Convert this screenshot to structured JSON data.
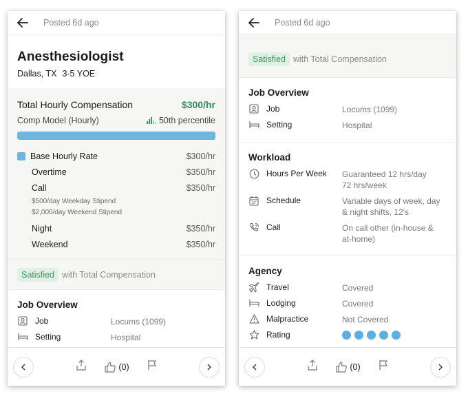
{
  "left": {
    "header": {
      "posted": "Posted 6d ago"
    },
    "job": {
      "title": "Anesthesiologist",
      "location": "Dallas, TX",
      "experience": "3-5 YOE"
    },
    "comp": {
      "label": "Total Hourly Compensation",
      "value": "$300/hr",
      "model": "Comp Model (Hourly)",
      "percentile": "50th percentile",
      "bar_fill_fraction": 1.0,
      "base": {
        "label": "Base Hourly Rate",
        "value": "$300/hr"
      },
      "overtime": {
        "label": "Overtime",
        "value": "$350/hr"
      },
      "call": {
        "label": "Call",
        "value": "$350/hr"
      },
      "stipend_weekday": "$500/day Weekday Stipend",
      "stipend_weekend": "$2,000/day Weekend Stipend",
      "night": {
        "label": "Night",
        "value": "$350/hr"
      },
      "weekend": {
        "label": "Weekend",
        "value": "$350/hr"
      }
    },
    "satisfaction": {
      "badge": "Satisfied",
      "text": "with Total Compensation"
    },
    "overview": {
      "title": "Job Overview",
      "job": {
        "label": "Job",
        "value": "Locums (1099)"
      },
      "setting": {
        "label": "Setting",
        "value": "Hospital"
      }
    },
    "footer": {
      "likes": "(0)"
    }
  },
  "right": {
    "header": {
      "posted": "Posted 6d ago"
    },
    "satisfaction": {
      "badge": "Satisfied",
      "text": "with Total Compensation"
    },
    "overview": {
      "title": "Job Overview",
      "job": {
        "label": "Job",
        "value": "Locums (1099)"
      },
      "setting": {
        "label": "Setting",
        "value": "Hospital"
      }
    },
    "workload": {
      "title": "Workload",
      "hours": {
        "label": "Hours Per Week",
        "value_1": "Guaranteed 12 hrs/day",
        "value_2": "72 hrs/week"
      },
      "schedule": {
        "label": "Schedule",
        "value_1": "Variable days of week, day",
        "value_2": "& night shifts, 12's"
      },
      "call": {
        "label": "Call",
        "value_1": "On call other (in-house &",
        "value_2": "at-home)"
      }
    },
    "agency": {
      "title": "Agency",
      "travel": {
        "label": "Travel",
        "value": "Covered"
      },
      "lodging": {
        "label": "Lodging",
        "value": "Covered"
      },
      "malpractice": {
        "label": "Malpractice",
        "value": "Not Covered"
      },
      "rating": {
        "label": "Rating",
        "stars": 5,
        "max": 5
      }
    },
    "footer": {
      "likes": "(0)"
    }
  },
  "colors": {
    "accent_green": "#2e8f5a",
    "bar_blue": "#6fb5e1",
    "dot_blue": "#5ab0e2",
    "badge_bg": "#dff1e5"
  }
}
